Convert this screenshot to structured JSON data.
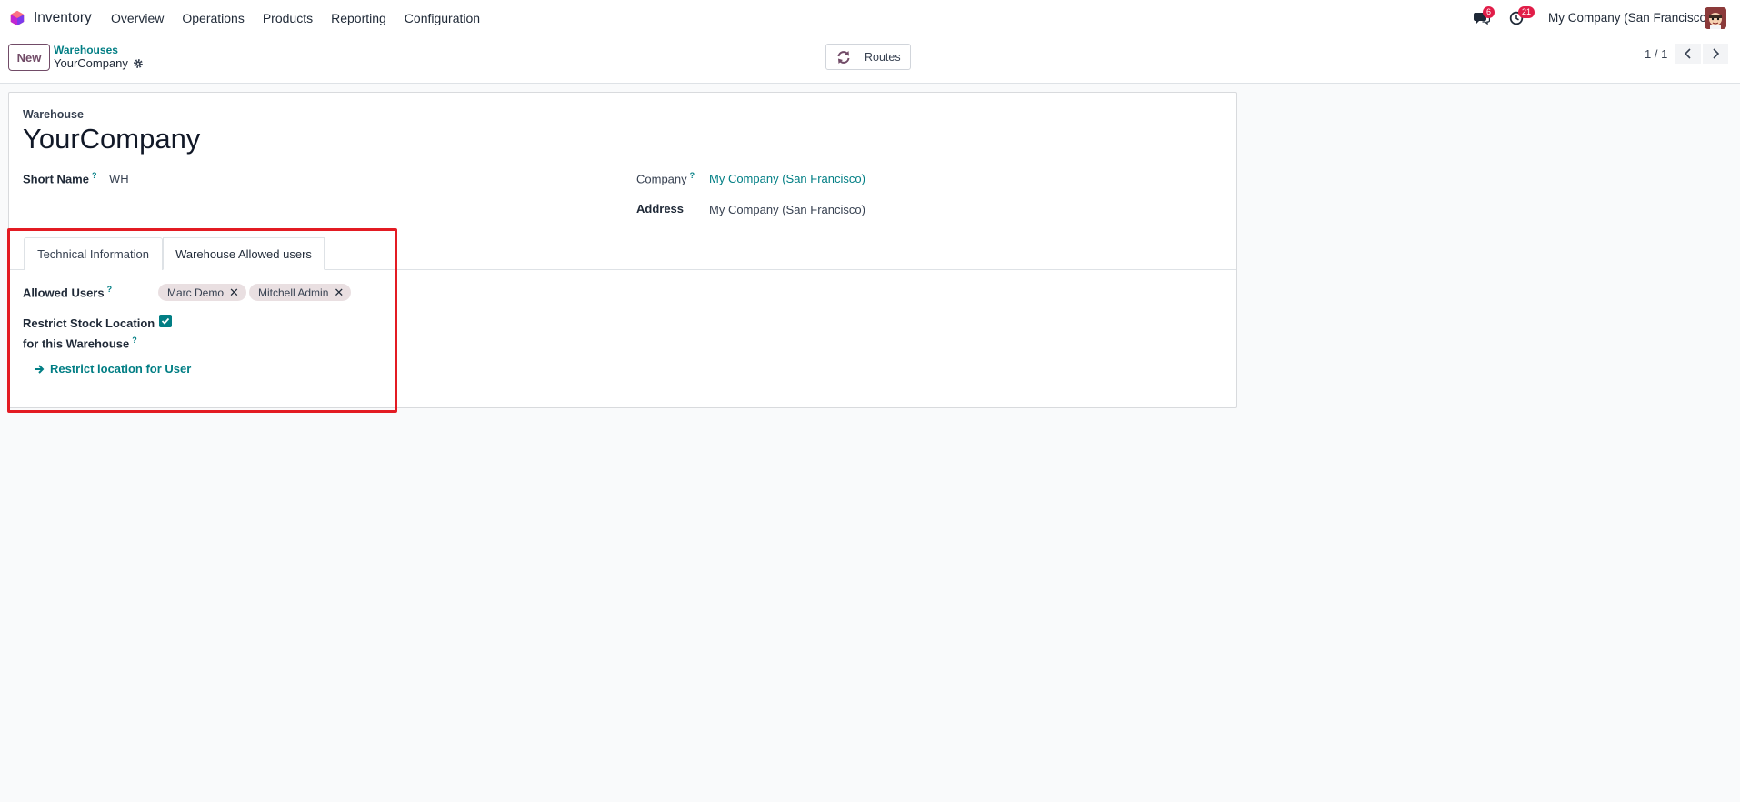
{
  "navbar": {
    "app_name": "Inventory",
    "menu": [
      "Overview",
      "Operations",
      "Products",
      "Reporting",
      "Configuration"
    ],
    "messages_count": "6",
    "activities_count": "21",
    "company": "My Company (San Francisco)"
  },
  "control_panel": {
    "new_label": "New",
    "breadcrumb_parent": "Warehouses",
    "breadcrumb_current": "YourCompany",
    "routes_label": "Routes",
    "pager": "1 / 1"
  },
  "form": {
    "record_type_label": "Warehouse",
    "title": "YourCompany",
    "short_name_label": "Short Name",
    "short_name_value": "WH",
    "company_label": "Company",
    "company_value": "My Company (San Francisco)",
    "address_label": "Address",
    "address_value": "My Company (San Francisco)",
    "help_mark": "?"
  },
  "tabs": {
    "technical": "Technical Information",
    "allowed_users": "Warehouse Allowed users"
  },
  "allowed_users_tab": {
    "allowed_users_label": "Allowed Users",
    "tags": [
      "Marc Demo",
      "Mitchell Admin"
    ],
    "tag_remove": "✕",
    "restrict_label_line1": "Restrict Stock Location",
    "restrict_label_line2": "for this Warehouse",
    "restrict_checked": true,
    "restrict_link": "Restrict location for User"
  },
  "colors": {
    "brand": "#714b67",
    "link": "#017e84",
    "highlight": "#e31b23",
    "badge": "#e11d48"
  }
}
